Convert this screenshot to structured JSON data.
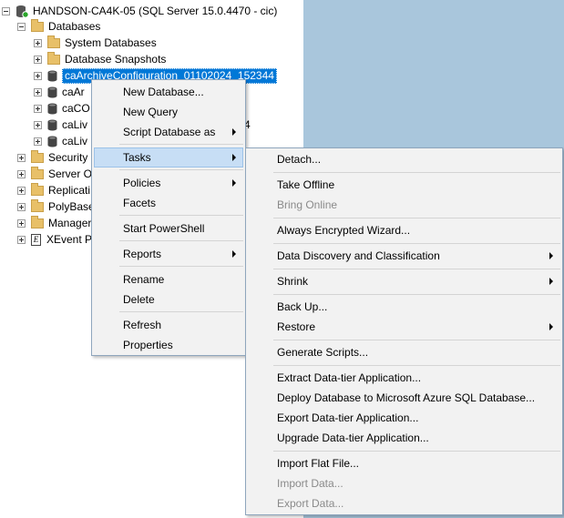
{
  "tree": {
    "server": "HANDSON-CA4K-05 (SQL Server 15.0.4470 - cic)",
    "databases": "Databases",
    "system_databases": "System Databases",
    "database_snapshots": "Database Snapshots",
    "db_selected": "caArchiveConfiguration_01102024_152344",
    "db2": "caAr",
    "db3": "caCO",
    "db4": "caLiv",
    "db4_tail": "4",
    "db5": "caLiv",
    "security": "Security",
    "server_objects": "Server O",
    "replication": "Replicati",
    "polybase": "PolyBase",
    "management": "Manager",
    "xevent": "XEvent P"
  },
  "context_menu": {
    "new_database": "New Database...",
    "new_query": "New Query",
    "script_database_as": "Script Database as",
    "tasks": "Tasks",
    "policies": "Policies",
    "facets": "Facets",
    "start_powershell": "Start PowerShell",
    "reports": "Reports",
    "rename": "Rename",
    "delete": "Delete",
    "refresh": "Refresh",
    "properties": "Properties"
  },
  "tasks_menu": {
    "detach": "Detach...",
    "take_offline": "Take Offline",
    "bring_online": "Bring Online",
    "always_encrypted": "Always Encrypted Wizard...",
    "data_discovery": "Data Discovery and Classification",
    "shrink": "Shrink",
    "back_up": "Back Up...",
    "restore": "Restore",
    "generate_scripts": "Generate Scripts...",
    "extract_dac": "Extract Data-tier Application...",
    "deploy_azure": "Deploy Database to Microsoft Azure SQL Database...",
    "export_dac": "Export Data-tier Application...",
    "upgrade_dac": "Upgrade Data-tier Application...",
    "import_flat_file": "Import Flat File...",
    "import_data": "Import Data...",
    "export_data": "Export Data..."
  },
  "colors": {
    "selection": "#0078d7",
    "menu_highlight": "#c7def5",
    "right_pane": "#a9c6dc",
    "disabled_text": "#8a8a8a"
  }
}
